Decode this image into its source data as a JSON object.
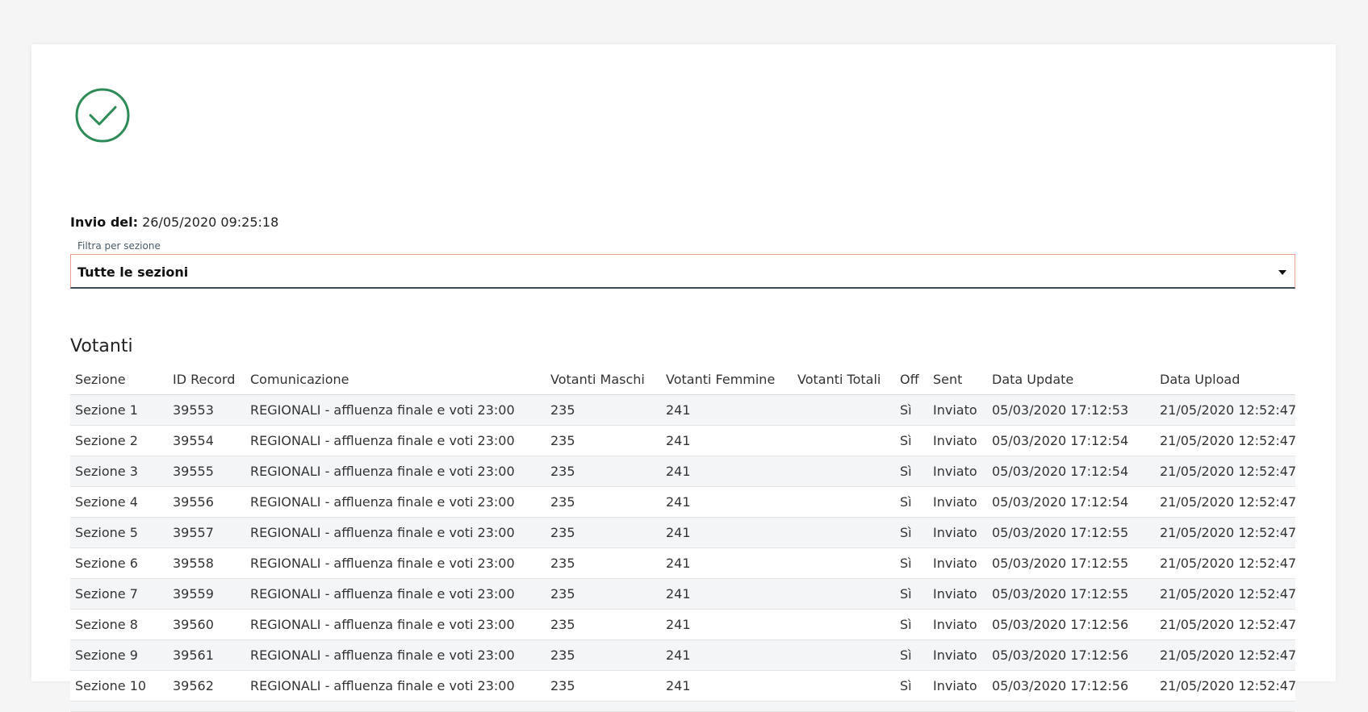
{
  "status": {
    "icon": "check-circle-icon",
    "color": "#2e8b57"
  },
  "sent": {
    "label": "Invio del:",
    "value": "26/05/2020 09:25:18"
  },
  "filter": {
    "label": "Filtra per sezione",
    "selected": "Tutte le sezioni"
  },
  "votanti": {
    "title": "Votanti",
    "columns": [
      "Sezione",
      "ID Record",
      "Comunicazione",
      "Votanti Maschi",
      "Votanti Femmine",
      "Votanti Totali",
      "Off",
      "Sent",
      "Data Update",
      "Data Upload"
    ],
    "rows": [
      [
        "Sezione 1",
        "39553",
        "REGIONALI - affluenza finale e voti 23:00",
        "235",
        "241",
        "",
        "Sì",
        "Inviato",
        "05/03/2020 17:12:53",
        "21/05/2020 12:52:47"
      ],
      [
        "Sezione 2",
        "39554",
        "REGIONALI - affluenza finale e voti 23:00",
        "235",
        "241",
        "",
        "Sì",
        "Inviato",
        "05/03/2020 17:12:54",
        "21/05/2020 12:52:47"
      ],
      [
        "Sezione 3",
        "39555",
        "REGIONALI - affluenza finale e voti 23:00",
        "235",
        "241",
        "",
        "Sì",
        "Inviato",
        "05/03/2020 17:12:54",
        "21/05/2020 12:52:47"
      ],
      [
        "Sezione 4",
        "39556",
        "REGIONALI - affluenza finale e voti 23:00",
        "235",
        "241",
        "",
        "Sì",
        "Inviato",
        "05/03/2020 17:12:54",
        "21/05/2020 12:52:47"
      ],
      [
        "Sezione 5",
        "39557",
        "REGIONALI - affluenza finale e voti 23:00",
        "235",
        "241",
        "",
        "Sì",
        "Inviato",
        "05/03/2020 17:12:55",
        "21/05/2020 12:52:47"
      ],
      [
        "Sezione 6",
        "39558",
        "REGIONALI - affluenza finale e voti 23:00",
        "235",
        "241",
        "",
        "Sì",
        "Inviato",
        "05/03/2020 17:12:55",
        "21/05/2020 12:52:47"
      ],
      [
        "Sezione 7",
        "39559",
        "REGIONALI - affluenza finale e voti 23:00",
        "235",
        "241",
        "",
        "Sì",
        "Inviato",
        "05/03/2020 17:12:55",
        "21/05/2020 12:52:47"
      ],
      [
        "Sezione 8",
        "39560",
        "REGIONALI - affluenza finale e voti 23:00",
        "235",
        "241",
        "",
        "Sì",
        "Inviato",
        "05/03/2020 17:12:56",
        "21/05/2020 12:52:47"
      ],
      [
        "Sezione 9",
        "39561",
        "REGIONALI - affluenza finale e voti 23:00",
        "235",
        "241",
        "",
        "Sì",
        "Inviato",
        "05/03/2020 17:12:56",
        "21/05/2020 12:52:47"
      ],
      [
        "Sezione 10",
        "39562",
        "REGIONALI - affluenza finale e voti 23:00",
        "235",
        "241",
        "",
        "Sì",
        "Inviato",
        "05/03/2020 17:12:56",
        "21/05/2020 12:52:47"
      ]
    ]
  }
}
